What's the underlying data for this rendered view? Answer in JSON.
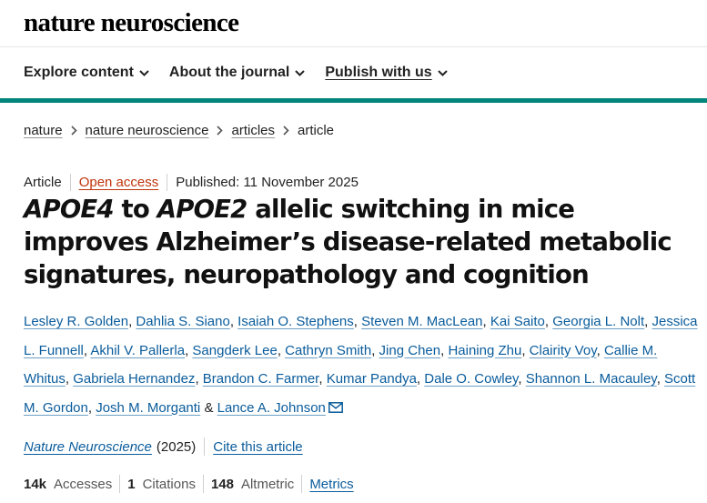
{
  "header": {
    "logo": "nature neuroscience"
  },
  "nav": {
    "items": [
      {
        "label": "Explore content"
      },
      {
        "label": "About the journal"
      },
      {
        "label": "Publish with us"
      }
    ]
  },
  "colors": {
    "accent": "#00857b",
    "link": "#0a5c9c",
    "open_access": "#c0340a"
  },
  "breadcrumb": {
    "items": [
      "nature",
      "nature neuroscience",
      "articles"
    ],
    "current": "article"
  },
  "meta": {
    "type": "Article",
    "access": "Open access",
    "published": "Published: 11 November 2025"
  },
  "title": {
    "gene1": "APOE4",
    "connector": " to ",
    "gene2": "APOE2",
    "rest": " allelic switching in mice improves Alzheimer’s disease-related metabolic signatures, neuropathology and cognition"
  },
  "authors": [
    "Lesley R. Golden",
    "Dahlia S. Siano",
    "Isaiah O. Stephens",
    "Steven M. MacLean",
    "Kai Saito",
    "Georgia L. Nolt",
    "Jessica L. Funnell",
    "Akhil V. Pallerla",
    "Sangderk Lee",
    "Cathryn Smith",
    "Jing Chen",
    "Haining Zhu",
    "Clairity Voy",
    "Callie M. Whitus",
    "Gabriela Hernandez",
    "Brandon C. Farmer",
    "Kumar Pandya",
    "Dale O. Cowley",
    "Shannon L. Macauley",
    "Scott M. Gordon",
    "Josh M. Morganti",
    "Lance A. Johnson"
  ],
  "authors_and": "&",
  "icons": {
    "nav_chevron": "chevron-down-icon",
    "breadcrumb_sep": "chevron-right-icon",
    "author_email": "mail-icon"
  },
  "citation": {
    "journal": "Nature Neuroscience",
    "year": "(2025)",
    "cite_label": "Cite this article"
  },
  "metrics": {
    "accesses_value": "14k",
    "accesses_label": "Accesses",
    "citations_value": "1",
    "citations_label": "Citations",
    "altmetric_value": "148",
    "altmetric_label": "Altmetric",
    "metrics_link": "Metrics"
  }
}
